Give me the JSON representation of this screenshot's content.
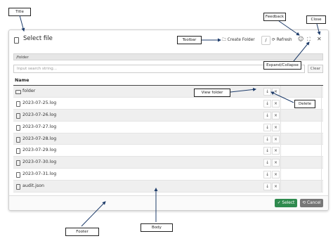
{
  "dialog": {
    "title": "Select file",
    "toolbar": {
      "create_folder_label": "Create Folder",
      "slash_label": "/",
      "refresh_label": "Refresh"
    },
    "path": "/folder",
    "search_placeholder": "Input search string...",
    "clear_label": "Clear",
    "table_header": "Name",
    "rows": [
      {
        "name": "folder",
        "type": "folder"
      },
      {
        "name": "2023-07-25.log",
        "type": "file"
      },
      {
        "name": "2023-07-26.log",
        "type": "file"
      },
      {
        "name": "2023-07-27.log",
        "type": "file"
      },
      {
        "name": "2023-07-28.log",
        "type": "file"
      },
      {
        "name": "2023-07-29.log",
        "type": "file"
      },
      {
        "name": "2023-07-30.log",
        "type": "file"
      },
      {
        "name": "2023-07-31.log",
        "type": "file"
      },
      {
        "name": "audit.json",
        "type": "file"
      }
    ],
    "view_glyph": "↓",
    "delete_glyph": "×",
    "footer": {
      "select_label": "✓ Select",
      "cancel_label": "⟲ Cancel"
    }
  },
  "annotations": {
    "title": "Title",
    "feedback": "Feedback",
    "close": "Close",
    "toolbar": "Toolbar",
    "expand_collapse": "Expand/Collapse",
    "view_folder": "View folder",
    "delete": "Delete",
    "footer": "Footer",
    "body": "Body"
  },
  "colors": {
    "select_button": "#2f8a4e",
    "cancel_button": "#777777",
    "path_bar": "#e6e6e6"
  }
}
